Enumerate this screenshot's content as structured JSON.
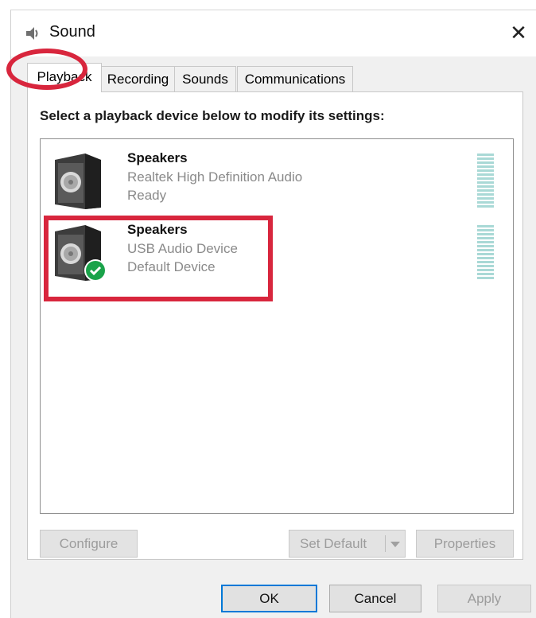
{
  "window": {
    "title": "Sound",
    "close_glyph": "✕"
  },
  "tabs": [
    {
      "label": "Playback",
      "active": true
    },
    {
      "label": "Recording",
      "active": false
    },
    {
      "label": "Sounds",
      "active": false
    },
    {
      "label": "Communications",
      "active": false
    }
  ],
  "panel": {
    "instruction": "Select a playback device below to modify its settings:",
    "devices": [
      {
        "name": "Speakers",
        "driver": "Realtek High Definition Audio",
        "status": "Ready",
        "default": false,
        "icon": "speaker-icon"
      },
      {
        "name": "Speakers",
        "driver": "USB Audio Device",
        "status": "Default Device",
        "default": true,
        "icon": "speaker-icon"
      }
    ],
    "buttons": {
      "configure": "Configure",
      "set_default": "Set Default",
      "properties": "Properties"
    }
  },
  "footer": {
    "ok": "OK",
    "cancel": "Cancel",
    "apply": "Apply"
  },
  "colors": {
    "annotation_red": "#d8263d",
    "meter_teal": "#a9d9d6",
    "default_check_green": "#1aa34a",
    "ok_border": "#0078d7"
  }
}
